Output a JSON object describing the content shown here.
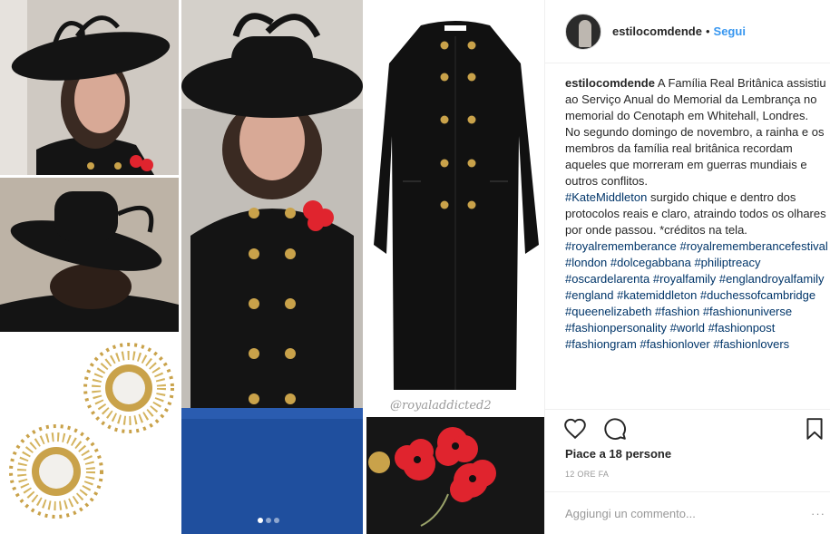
{
  "post": {
    "username": "estilocomdende",
    "follow_label": "Segui",
    "separator": "•",
    "caption": {
      "author": "estilocomdende",
      "text_1": "A Família Real Britânica assistiu ao Serviço Anual do Memorial da Lembrança no memorial do Cenotaph em Whitehall, Londres.",
      "text_2": "No segundo domingo de novembro, a rainha e os membros da família real britânica recordam aqueles que morreram em guerras mundiais e outros conflitos.",
      "mention": "#KateMiddleton",
      "text_3": "surgido chique e dentro dos protocolos reais e claro, atraindo todos os olhares por onde passou. *créditos na tela.",
      "hashtags": [
        "#royalrememberance",
        "#royalrememberancefestival",
        "#london",
        "#dolcegabbana",
        "#philiptreacy",
        "#oscardelarenta",
        "#royalfamily",
        "#englandroyalfamily",
        "#england",
        "#katemiddleton",
        "#duchessofcambridge",
        "#queenelizabeth",
        "#fashion",
        "#fashionuniverse",
        "#fashionpersonality",
        "#world",
        "#fashionpost",
        "#fashiongram",
        "#fashionlover",
        "#fashionlovers"
      ]
    },
    "likes_text": "Piace a 18 persone",
    "time_ago": "12 ORE FA",
    "comment_placeholder": "Aggiungi un commento...",
    "comment_more": "···",
    "image_watermark": "@royaladdicted2",
    "carousel": {
      "count": 3,
      "active": 1
    }
  },
  "icons": {
    "like": "heart-icon",
    "comment": "comment-icon",
    "save": "bookmark-icon"
  },
  "colors": {
    "link": "#003569",
    "follow": "#3897f0",
    "text": "#262626",
    "muted": "#999999",
    "coat": "#111111",
    "buttons": "#c9a24a",
    "poppy": "#e0242e",
    "carpet": "#1f4f9e"
  }
}
